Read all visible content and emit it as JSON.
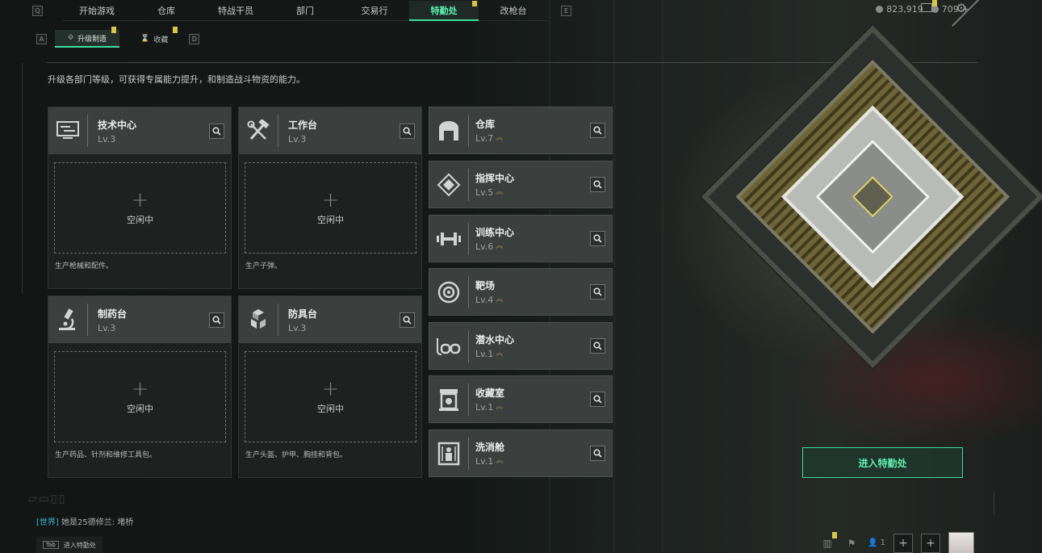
{
  "nav": {
    "left_key": "Q",
    "right_key": "E",
    "tabs": [
      {
        "label": "开始游戏"
      },
      {
        "label": "仓库"
      },
      {
        "label": "特战干员"
      },
      {
        "label": "部门"
      },
      {
        "label": "交易行"
      },
      {
        "label": "特勤处",
        "active": true,
        "alert": true
      },
      {
        "label": "改枪台"
      }
    ]
  },
  "resources": {
    "coins": "823,919",
    "tickets": "709",
    "add": "+"
  },
  "subnav": {
    "left_key": "A",
    "right_key": "D",
    "tabs": [
      {
        "label": "升级制造",
        "active": true
      },
      {
        "label": "收藏"
      }
    ]
  },
  "description": "升级各部门等级，可获得专属能力提升，和制造战斗物资的能力。",
  "workshops": [
    {
      "name": "技术中心",
      "level": "Lv.3",
      "icon": "computer-icon",
      "slot": {
        "plus": "+",
        "status": "空闲中"
      },
      "product": "生产枪械和配件。"
    },
    {
      "name": "工作台",
      "level": "Lv.3",
      "icon": "tools-icon",
      "slot": {
        "plus": "+",
        "status": "空闲中"
      },
      "product": "生产子弹。"
    },
    {
      "name": "制药台",
      "level": "Lv.3",
      "icon": "microscope-icon",
      "slot": {
        "plus": "+",
        "status": "空闲中"
      },
      "product": "生产药品、针剂和维修工具包。"
    },
    {
      "name": "防具台",
      "level": "Lv.3",
      "icon": "armor-cubes-icon",
      "slot": {
        "plus": "+",
        "status": "空闲中"
      },
      "product": "生产头盔、护甲、胸挂和背包。"
    }
  ],
  "departments": [
    {
      "name": "仓库",
      "level": "Lv.7",
      "icon": "warehouse-icon"
    },
    {
      "name": "指挥中心",
      "level": "Lv.5",
      "icon": "command-center-icon"
    },
    {
      "name": "训练中心",
      "level": "Lv.6",
      "icon": "dumbbell-icon"
    },
    {
      "name": "靶场",
      "level": "Lv.4",
      "icon": "target-icon"
    },
    {
      "name": "潜水中心",
      "level": "Lv.1",
      "icon": "diving-mask-icon"
    },
    {
      "name": "收藏室",
      "level": "Lv.1",
      "icon": "collection-room-icon"
    },
    {
      "name": "洗消舱",
      "level": "Lv.1",
      "icon": "decon-chamber-icon"
    }
  ],
  "level_up_marker": "︽",
  "enter_button": "进入特勤处",
  "chat": {
    "channel": "[世界]",
    "message": "她是25德修兰: 堵桥"
  },
  "tab_hint": {
    "key": "Tab",
    "label": "进入特勤处"
  },
  "bottom": {
    "friends_count": "1",
    "plus": "+"
  },
  "colors": {
    "accent": "#3fdca0",
    "alert": "#d9c34b",
    "panel": "#3b403f"
  }
}
